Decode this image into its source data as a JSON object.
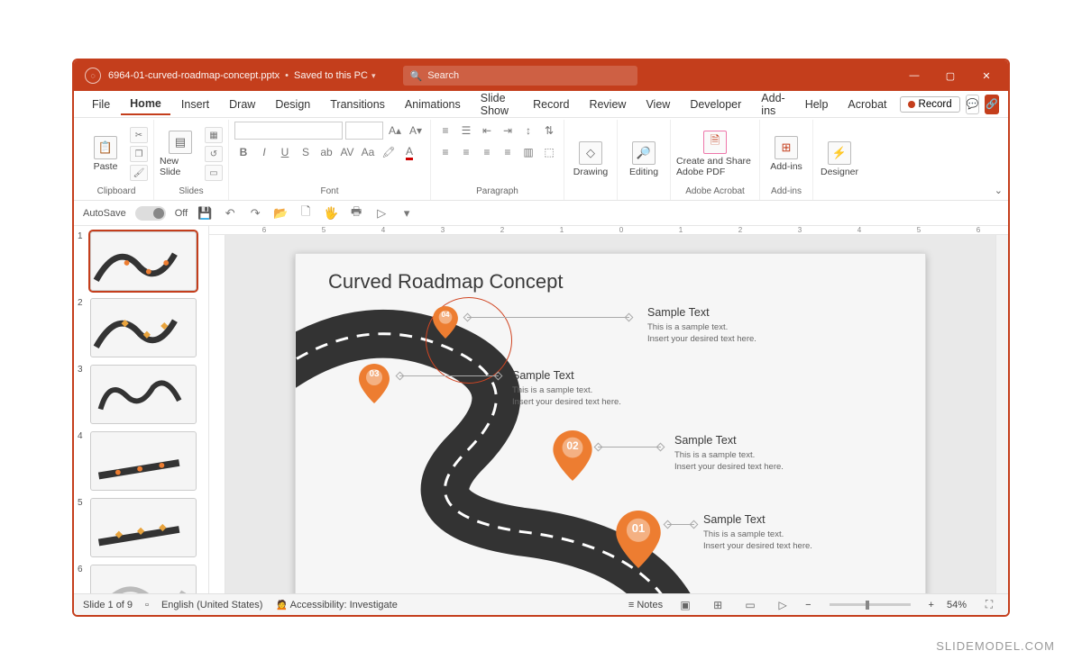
{
  "titlebar": {
    "filename": "6964-01-curved-roadmap-concept.pptx",
    "saved": "Saved to this PC",
    "search_placeholder": "Search"
  },
  "menu": {
    "tabs": [
      "File",
      "Home",
      "Insert",
      "Draw",
      "Design",
      "Transitions",
      "Animations",
      "Slide Show",
      "Record",
      "Review",
      "View",
      "Developer",
      "Add-ins",
      "Help",
      "Acrobat"
    ],
    "active": "Home",
    "record": "Record"
  },
  "ribbon": {
    "clipboard": {
      "label": "Clipboard",
      "paste": "Paste"
    },
    "slides": {
      "label": "Slides",
      "newslide": "New Slide"
    },
    "font": {
      "label": "Font"
    },
    "paragraph": {
      "label": "Paragraph"
    },
    "drawing": {
      "label": "Drawing",
      "btn": "Drawing"
    },
    "editing": {
      "label": "Editing",
      "btn": "Editing"
    },
    "acrobat": {
      "label": "Adobe Acrobat",
      "btn": "Create and Share Adobe PDF"
    },
    "addins": {
      "label": "Add-ins",
      "btn": "Add-ins"
    },
    "designer": {
      "btn": "Designer"
    }
  },
  "qat": {
    "autosave": "AutoSave",
    "off": "Off"
  },
  "thumbs": {
    "count": 6,
    "active": 1
  },
  "slide": {
    "title": "Curved Roadmap Concept",
    "pins": [
      {
        "num": "01"
      },
      {
        "num": "02"
      },
      {
        "num": "03"
      },
      {
        "num": "04"
      }
    ],
    "blocks": [
      {
        "h": "Sample Text",
        "b1": "This is a sample text.",
        "b2": "Insert your desired text here."
      },
      {
        "h": "Sample Text",
        "b1": "This is a sample text.",
        "b2": "Insert your desired text here."
      },
      {
        "h": "Sample Text",
        "b1": "This is a sample text.",
        "b2": "Insert your desired text here."
      },
      {
        "h": "Sample Text",
        "b1": "This is a sample text.",
        "b2": "Insert your desired text here."
      }
    ]
  },
  "ruler": [
    "6",
    "5",
    "4",
    "3",
    "2",
    "1",
    "0",
    "1",
    "2",
    "3",
    "4",
    "5",
    "6"
  ],
  "status": {
    "slide": "Slide 1 of 9",
    "lang": "English (United States)",
    "access": "Accessibility: Investigate",
    "notes": "Notes",
    "zoom": "54%"
  },
  "watermark": "SLIDEMODEL.COM"
}
